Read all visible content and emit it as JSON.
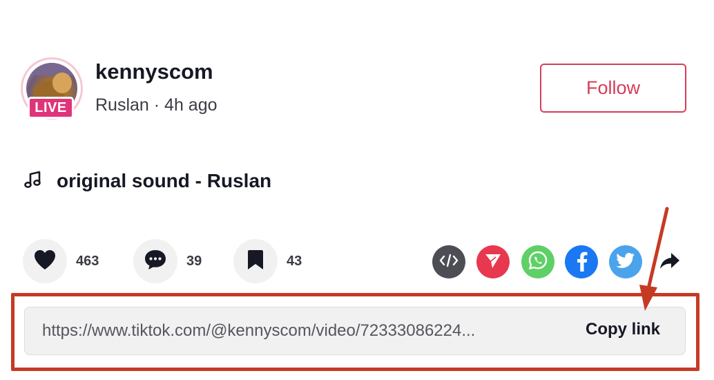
{
  "author": {
    "username": "kennyscom",
    "subline": "Ruslan · 4h ago",
    "live_label": "LIVE"
  },
  "follow_label": "Follow",
  "sound": {
    "icon": "music-note-icon",
    "text": "original sound - Ruslan"
  },
  "actions": {
    "likes": {
      "icon": "heart-icon",
      "count": "463"
    },
    "comments": {
      "icon": "comment-icon",
      "count": "39"
    },
    "favorites": {
      "icon": "bookmark-icon",
      "count": "43"
    }
  },
  "share_icons": [
    "embed-icon",
    "send-icon",
    "whatsapp-icon",
    "facebook-icon",
    "twitter-icon",
    "share-arrow-icon"
  ],
  "link": {
    "url": "https://www.tiktok.com/@kennyscom/video/72333086224...",
    "copy_label": "Copy link"
  },
  "colors": {
    "accent": "#d63c58",
    "live": "#e0347a",
    "annotation": "#c63a24",
    "embed": "#4d4e55",
    "send": "#e8384f",
    "whatsapp": "#5fd066",
    "facebook": "#1a78f2",
    "twitter": "#4ba3ec"
  }
}
